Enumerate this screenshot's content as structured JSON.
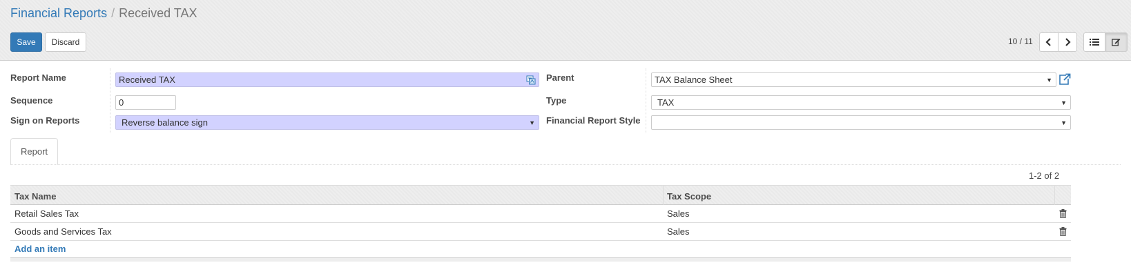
{
  "breadcrumb": {
    "parent": "Financial Reports",
    "separator": "/",
    "current": "Received TAX"
  },
  "toolbar": {
    "save_label": "Save",
    "discard_label": "Discard"
  },
  "pager": {
    "value": "10 / 11"
  },
  "form": {
    "report_name_label": "Report Name",
    "report_name_value": "Received TAX",
    "sequence_label": "Sequence",
    "sequence_value": "0",
    "sign_label": "Sign on Reports",
    "sign_value": "Reverse balance sign",
    "parent_label": "Parent",
    "parent_value": "TAX Balance Sheet",
    "type_label": "Type",
    "type_value": "TAX",
    "style_label": "Financial Report Style",
    "style_value": ""
  },
  "tabs": [
    {
      "label": "Report"
    }
  ],
  "list": {
    "count": "1-2 of 2",
    "columns": [
      "Tax Name",
      "Tax Scope"
    ],
    "rows": [
      {
        "name": "Retail Sales Tax",
        "scope": "Sales"
      },
      {
        "name": "Goods and Services Tax",
        "scope": "Sales"
      }
    ],
    "add_label": "Add an item"
  },
  "icons": {
    "translate": "translate-icon",
    "external": "external-link-icon",
    "prev": "chevron-left-icon",
    "next": "chevron-right-icon",
    "list": "list-view-icon",
    "form": "form-view-edit-icon",
    "trash": "trash-icon",
    "caret": "caret-down-icon"
  },
  "colors": {
    "accent": "#337ab7",
    "required": "#d2d2ff"
  }
}
